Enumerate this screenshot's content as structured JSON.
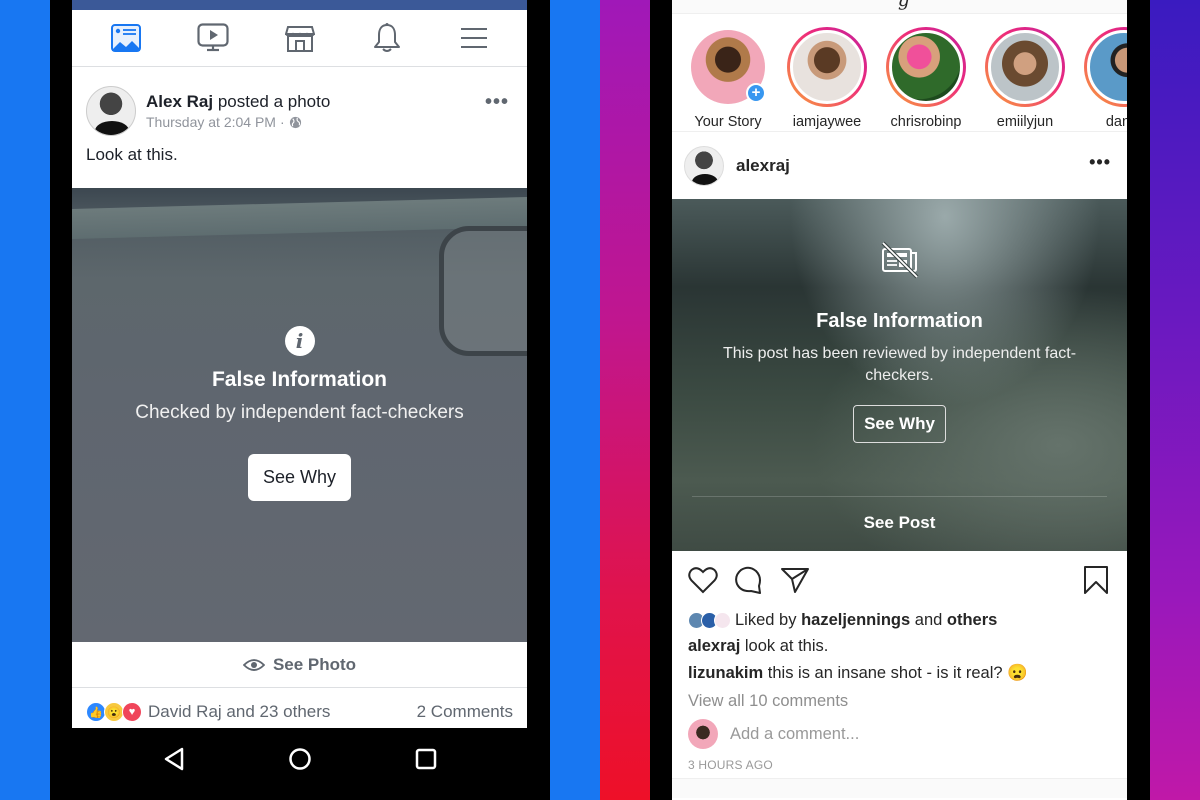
{
  "colors": {
    "facebook_blue": "#1877f2",
    "facebook_header": "#3b5998",
    "instagram_gradient": [
      "#a018b8",
      "#c0168f",
      "#e0134b",
      "#ee1028"
    ],
    "instagram_story_blue": "#3897f0"
  },
  "facebook": {
    "nav_icons": [
      "news-feed-icon",
      "watch-icon",
      "marketplace-icon",
      "notifications-icon",
      "menu-icon"
    ],
    "post": {
      "author": "Alex Raj",
      "action": "posted a photo",
      "timestamp": "Thursday at 2:04 PM",
      "separator": "·",
      "privacy_icon": "globe-icon",
      "more_label": "•••",
      "text": "Look at this."
    },
    "warning": {
      "icon": "info-icon",
      "icon_glyph": "i",
      "title": "False Information",
      "subtitle": "Checked by independent fact-checkers",
      "button": "See Why"
    },
    "see_photo": "See Photo",
    "reactions": {
      "types": [
        "like",
        "wow",
        "love"
      ],
      "text": "David Raj and 23 others",
      "comments": "2 Comments"
    },
    "system_nav": [
      "back-icon",
      "home-icon",
      "recents-icon"
    ]
  },
  "instagram": {
    "stories": [
      {
        "name": "Your Story",
        "own": true
      },
      {
        "name": "iamjaywee"
      },
      {
        "name": "chrisrobinp"
      },
      {
        "name": "emiilyjun"
      },
      {
        "name": "danto"
      }
    ],
    "add_story_glyph": "+",
    "post": {
      "username": "alexraj",
      "more_label": "•••"
    },
    "warning": {
      "icon": "false-news-icon",
      "title": "False Information",
      "subtitle": "This post has been reviewed by independent fact-checkers.",
      "button": "See Why",
      "see_post": "See Post"
    },
    "likes": {
      "prefix": "Liked by",
      "user": "hazeljennings",
      "joiner": "and",
      "suffix": "others"
    },
    "caption": {
      "user": "alexraj",
      "text": "look at this."
    },
    "comment": {
      "user": "lizunakim",
      "text": "this is an insane shot - is it real? 😦"
    },
    "view_all": "View all 10 comments",
    "add_comment_placeholder": "Add a comment...",
    "time_ago": "3 HOURS AGO"
  }
}
